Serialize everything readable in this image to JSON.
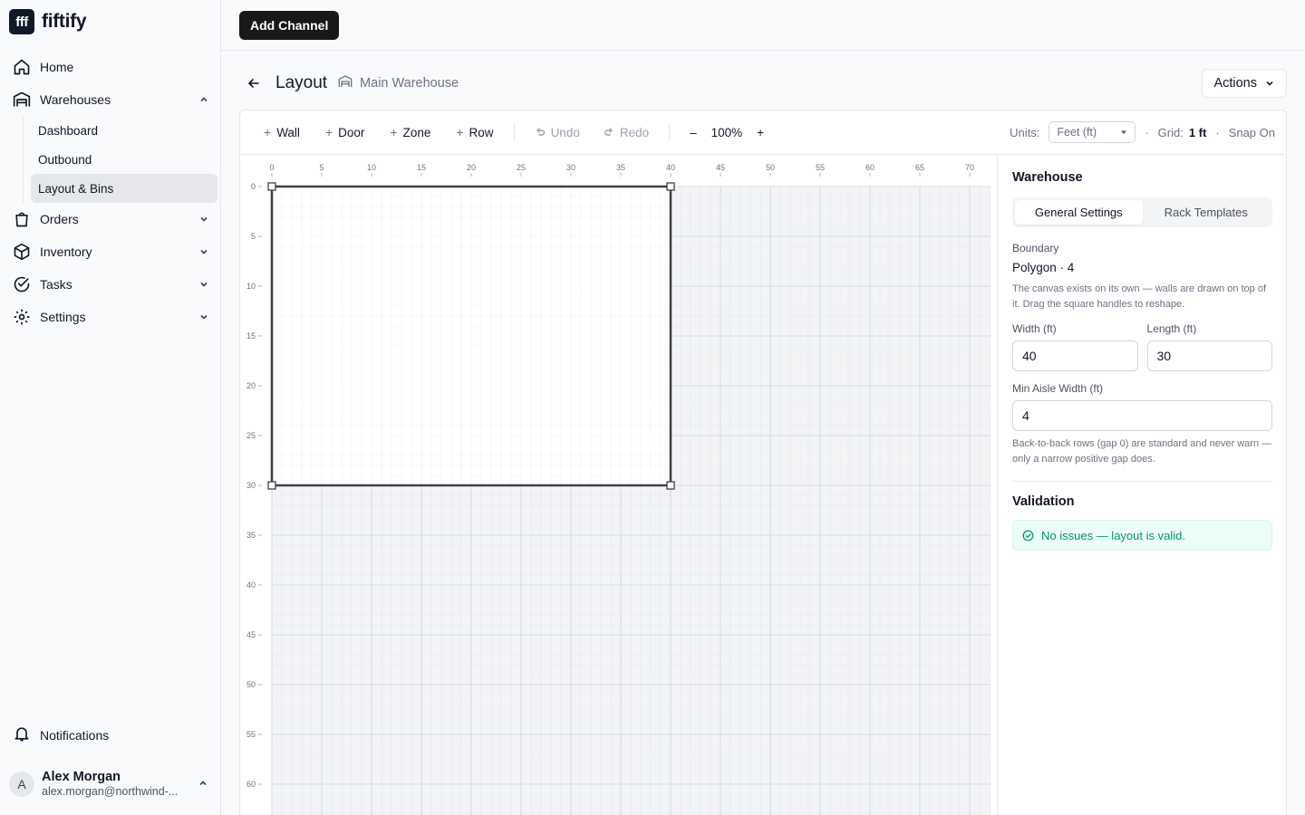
{
  "brand": {
    "logo_text": "fff",
    "name": "fiftify"
  },
  "sidebar": {
    "items": [
      {
        "label": "Home",
        "icon": "home-icon"
      },
      {
        "label": "Warehouses",
        "icon": "warehouse-icon",
        "expanded": true,
        "children": [
          {
            "label": "Dashboard"
          },
          {
            "label": "Outbound"
          },
          {
            "label": "Layout & Bins",
            "active": true
          }
        ]
      },
      {
        "label": "Orders",
        "icon": "shopping-bag-icon"
      },
      {
        "label": "Inventory",
        "icon": "box-icon"
      },
      {
        "label": "Tasks",
        "icon": "check-circle-icon"
      },
      {
        "label": "Settings",
        "icon": "gear-icon"
      }
    ],
    "notifications_label": "Notifications",
    "user": {
      "initial": "A",
      "name": "Alex Morgan",
      "email": "alex.morgan@northwind-..."
    }
  },
  "topbar": {
    "add_channel_label": "Add Channel"
  },
  "header": {
    "title": "Layout",
    "breadcrumb": "Main Warehouse",
    "actions_label": "Actions"
  },
  "toolbar": {
    "wall": "Wall",
    "door": "Door",
    "zone": "Zone",
    "row": "Row",
    "undo": "Undo",
    "redo": "Redo",
    "zoom_out": "–",
    "zoom": "100%",
    "zoom_in": "+",
    "units_label": "Units:",
    "units_value": "Feet (ft)",
    "grid_label": "Grid:",
    "grid_value": "1 ft",
    "snap": "Snap On",
    "dot": "·"
  },
  "canvas": {
    "x_ticks": [
      "0",
      "5",
      "10",
      "15",
      "20",
      "25",
      "30",
      "35",
      "40",
      "45",
      "50",
      "55",
      "60",
      "65",
      "70"
    ],
    "y_ticks": [
      "0",
      "5",
      "10",
      "15",
      "20",
      "25",
      "30",
      "35",
      "40",
      "45",
      "50",
      "55",
      "60"
    ],
    "boundary": {
      "width_ft": 40,
      "length_ft": 30
    }
  },
  "panel": {
    "title": "Warehouse",
    "tabs": [
      "General Settings",
      "Rack Templates"
    ],
    "boundary_label": "Boundary",
    "boundary_value": "Polygon · 4",
    "boundary_hint": "The canvas exists on its own — walls are drawn on top of it. Drag the square handles to reshape.",
    "width_label": "Width (ft)",
    "width_value": "40",
    "length_label": "Length (ft)",
    "length_value": "30",
    "aisle_label": "Min Aisle Width (ft)",
    "aisle_value": "4",
    "aisle_hint": "Back-to-back rows (gap 0) are standard and never warn — only a narrow positive gap does.",
    "validation_title": "Validation",
    "validation_message": "No issues — layout is valid."
  },
  "colors": {
    "accent_dark": "#18181b",
    "success": "#059669",
    "success_bg": "#ecfdf5"
  }
}
